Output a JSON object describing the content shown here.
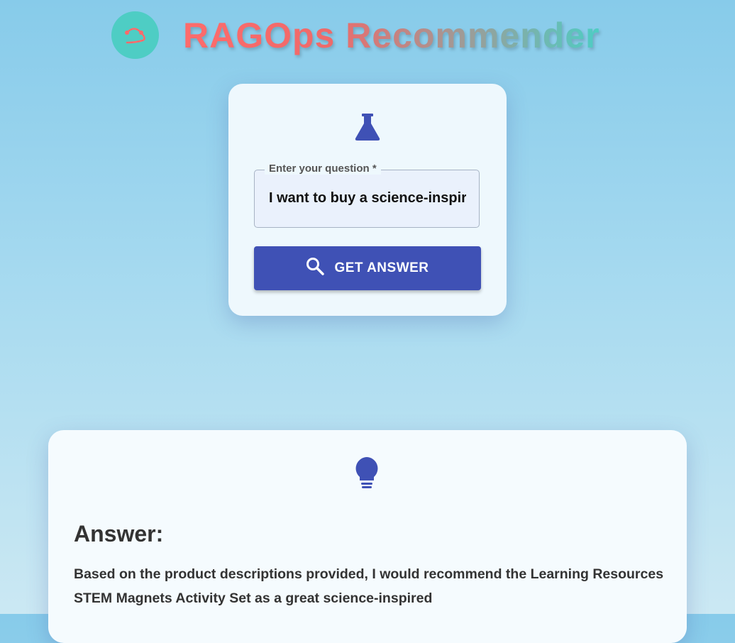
{
  "header": {
    "title": "RAGOps Recommender",
    "logo_icon": "smile-logo-icon",
    "colors": {
      "logo_bg": "#4ecdc4",
      "title_start": "#ff6b6b",
      "title_end": "#4ecdc4"
    }
  },
  "question_card": {
    "icon": "flask-icon",
    "field_label": "Enter your question *",
    "field_value": "I want to buy a science-inspired toy",
    "button_label": "GET ANSWER",
    "button_icon": "search-icon",
    "accent": "#3f51b5"
  },
  "answer_card": {
    "icon": "lightbulb-icon",
    "title": "Answer:",
    "text": "Based on the product descriptions provided, I would recommend the Learning Resources STEM Magnets Activity Set as a great science-inspired"
  }
}
